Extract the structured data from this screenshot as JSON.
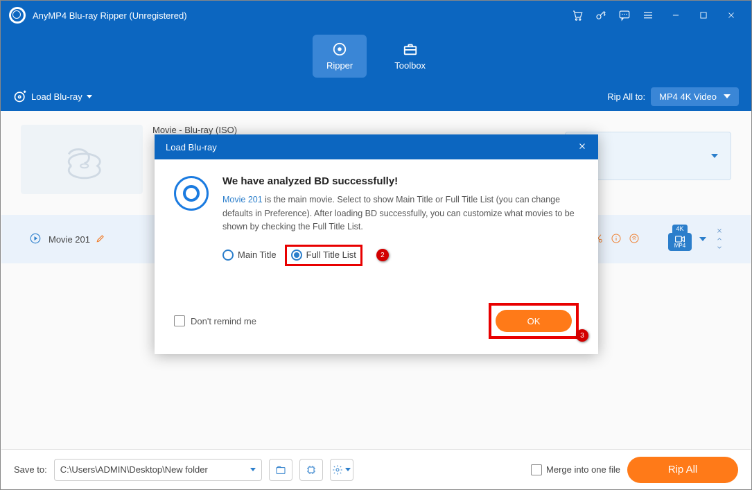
{
  "window": {
    "title": "AnyMP4 Blu-ray Ripper (Unregistered)"
  },
  "tabs": {
    "ripper": "Ripper",
    "toolbox": "Toolbox"
  },
  "toolbar": {
    "load_label": "Load Blu-ray",
    "rip_to_label": "Rip All to:",
    "format_label": "MP4 4K Video"
  },
  "movie": {
    "name": "Movie - Blu-ray (ISO)",
    "track_label": "Movie 201"
  },
  "format_badge": {
    "tag": "4K",
    "ext": "MP4"
  },
  "footer": {
    "save_label": "Save to:",
    "path": "C:\\Users\\ADMIN\\Desktop\\New folder",
    "merge_label": "Merge into one file",
    "rip_label": "Rip All"
  },
  "dialog": {
    "title": "Load Blu-ray",
    "heading": "We have analyzed BD successfully!",
    "movie_link": "Movie 201",
    "body_text": " is the main movie. Select to show Main Title or Full Title List (you can change defaults in Preference). After loading BD successfully, you can customize what movies to be shown by checking the Full Title List.",
    "radio_main": "Main Title",
    "radio_full": "Full Title List",
    "remind_label": "Don't remind me",
    "ok_label": "OK"
  },
  "callouts": {
    "c2": "2",
    "c3": "3"
  }
}
